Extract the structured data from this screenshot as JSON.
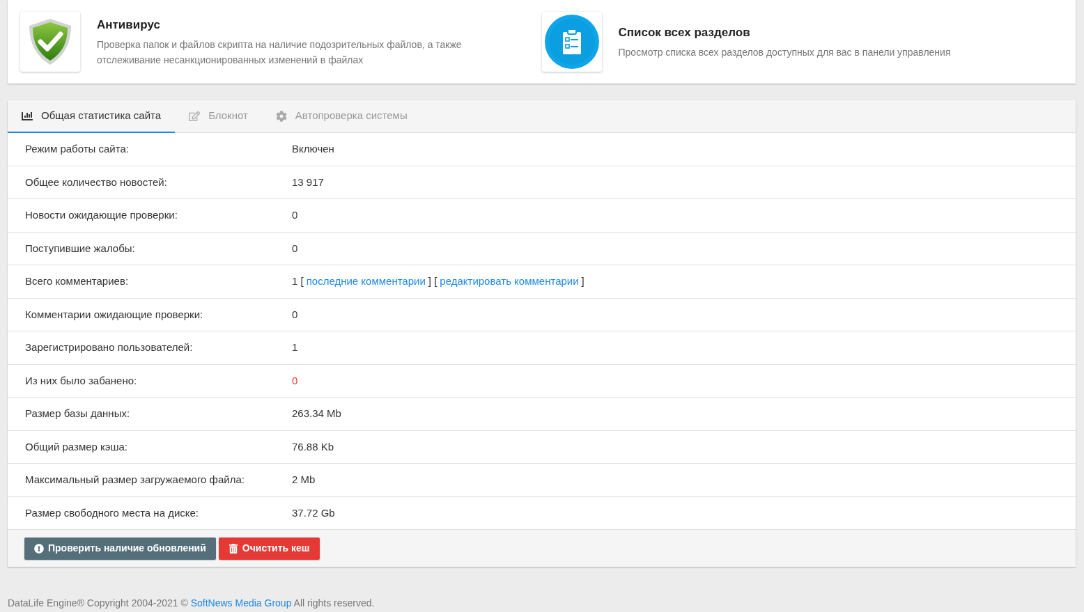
{
  "shortcuts": [
    {
      "kind": "shield",
      "title": "Антивирус",
      "description": "Проверка папок и файлов скрипта на наличие подозрительных файлов, а также отслеживание несанкционированных изменений в файлах"
    },
    {
      "kind": "clipboard",
      "title": "Список всех разделов",
      "description": "Просмотр списка всех разделов доступных для вас в панели управления"
    }
  ],
  "tabs": [
    {
      "kind": "chart",
      "label": "Общая статистика сайта",
      "selected": true
    },
    {
      "kind": "edit",
      "label": "Блокнот",
      "selected": false
    },
    {
      "kind": "gear",
      "label": "Автопроверка системы",
      "selected": false
    }
  ],
  "stats": [
    {
      "label": "Режим работы сайта:",
      "value": [
        {
          "kind": "text",
          "text": "Включен"
        }
      ],
      "alert": false
    },
    {
      "label": "Общее количество новостей:",
      "value": [
        {
          "kind": "text",
          "text": "13 917"
        }
      ],
      "alert": false
    },
    {
      "label": "Новости ожидающие проверки:",
      "value": [
        {
          "kind": "text",
          "text": "0"
        }
      ],
      "alert": false
    },
    {
      "label": "Поступившие жалобы:",
      "value": [
        {
          "kind": "text",
          "text": "0"
        }
      ],
      "alert": false
    },
    {
      "label": "Всего комментариев:",
      "value": [
        {
          "kind": "text",
          "text": "1 ["
        },
        {
          "kind": "link",
          "text": "последние комментарии"
        },
        {
          "kind": "text",
          "text": "] ["
        },
        {
          "kind": "link",
          "text": "редактировать комментарии"
        },
        {
          "kind": "text",
          "text": "]"
        }
      ],
      "alert": false
    },
    {
      "label": "Комментарии ожидающие проверки:",
      "value": [
        {
          "kind": "text",
          "text": "0"
        }
      ],
      "alert": false
    },
    {
      "label": "Зарегистрировано пользователей:",
      "value": [
        {
          "kind": "text",
          "text": "1"
        }
      ],
      "alert": false
    },
    {
      "label": "Из них было забанено:",
      "value": [
        {
          "kind": "text",
          "text": "0"
        }
      ],
      "alert": true
    },
    {
      "label": "Размер базы данных:",
      "value": [
        {
          "kind": "text",
          "text": "263.34 Mb"
        }
      ],
      "alert": false
    },
    {
      "label": "Общий размер кэша:",
      "value": [
        {
          "kind": "text",
          "text": "76.88 Kb"
        }
      ],
      "alert": false
    },
    {
      "label": "Максимальный размер загружаемого файла:",
      "value": [
        {
          "kind": "text",
          "text": "2 Mb"
        }
      ],
      "alert": false
    },
    {
      "label": "Размер свободного места на диске:",
      "value": [
        {
          "kind": "text",
          "text": "37.72 Gb"
        }
      ],
      "alert": false
    }
  ],
  "buttons": [
    {
      "kind": "update",
      "label": "Проверить наличие обновлений"
    },
    {
      "kind": "clear",
      "label": "Очистить кеш"
    }
  ],
  "footer": {
    "before": "DataLife Engine® Copyright 2004-2021 ©",
    "link": "SoftNews Media Group",
    "after": "All rights reserved."
  }
}
